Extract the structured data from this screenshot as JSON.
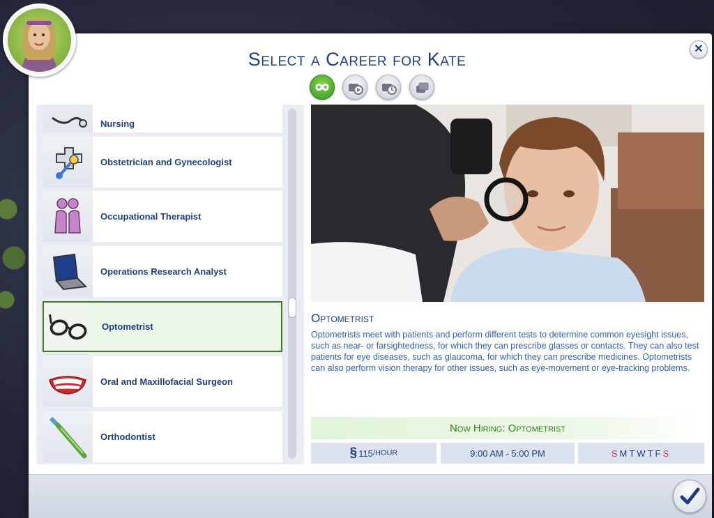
{
  "dialog": {
    "title": "Select a Career for Kate",
    "close_label": "✕"
  },
  "filters": [
    {
      "icon": "infinity-icon",
      "label": "∞",
      "active": true
    },
    {
      "icon": "part-time-icon",
      "active": false
    },
    {
      "icon": "odd-job-icon",
      "active": false
    },
    {
      "icon": "freelance-icon",
      "active": false
    }
  ],
  "career_list": {
    "items": [
      {
        "label": "Nursing",
        "icon": "stethoscope-icon"
      },
      {
        "label": "Obstetrician and Gynecologist",
        "icon": "baby-rattle-icon"
      },
      {
        "label": "Occupational Therapist",
        "icon": "people-icon"
      },
      {
        "label": "Operations Research Analyst",
        "icon": "laptop-icon"
      },
      {
        "label": "Optometrist",
        "icon": "glasses-icon",
        "selected": true
      },
      {
        "label": "Oral and Maxillofacial Surgeon",
        "icon": "teeth-icon"
      },
      {
        "label": "Orthodontist",
        "icon": "toothbrush-icon"
      }
    ]
  },
  "detail": {
    "name": "Optometrist",
    "description": "Optometrists meet with patients and perform different tests to determine common eyesight issues, such as near- or farsightedness, for which they can prescribe glasses or contacts. They can also test patients for eye diseases, such as glaucoma, for which they can prescribe medicines. Optometrists can also perform vision therapy for other issues, such as eye-movement or eye-tracking problems.",
    "hiring": "Now Hiring: Optometrist",
    "pay_symbol": "§",
    "pay_amount": "115",
    "pay_unit": "/HOUR",
    "hours": "9:00 AM - 5:00 PM",
    "days": [
      {
        "d": "S",
        "color": "#d63b3b"
      },
      {
        "d": "M",
        "color": "#1e3f86"
      },
      {
        "d": "T",
        "color": "#1e3f86"
      },
      {
        "d": "W",
        "color": "#1e3f86"
      },
      {
        "d": "T",
        "color": "#1e3f86"
      },
      {
        "d": "F",
        "color": "#1e3f86"
      },
      {
        "d": "S",
        "color": "#d63b3b"
      }
    ]
  },
  "colors": {
    "accent": "#1e3f86",
    "link": "#2a5fd0",
    "hiring": "#2f7d18"
  }
}
